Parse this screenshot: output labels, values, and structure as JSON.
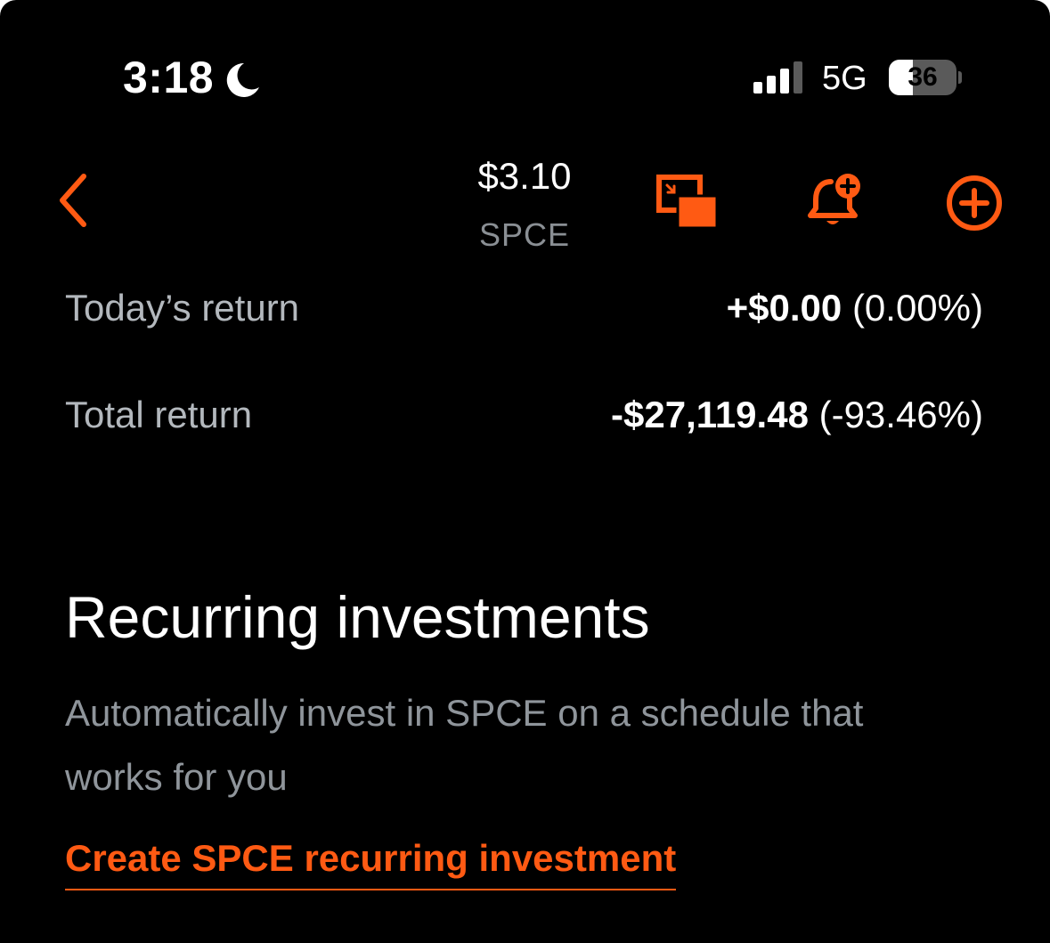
{
  "status_bar": {
    "time": "3:18",
    "network": "5G",
    "battery_percent": "36",
    "battery_level": 0.36
  },
  "header": {
    "price": "$3.10",
    "ticker": "SPCE"
  },
  "returns": {
    "today": {
      "label": "Today’s return",
      "amount": "+$0.00",
      "percent": "(0.00%)"
    },
    "total": {
      "label": "Total return",
      "amount": "-$27,119.48",
      "percent": "(-93.46%)"
    }
  },
  "recurring": {
    "title": "Recurring investments",
    "description": "Automatically invest in SPCE on a schedule that works for you",
    "create_link": "Create SPCE recurring investment"
  },
  "colors": {
    "accent": "#ff5a13",
    "background": "#000000",
    "muted_text": "#8f959b"
  },
  "icons": {
    "back": "chevron-left-icon",
    "pip": "picture-in-picture-icon",
    "alert": "bell-plus-icon",
    "add": "plus-circle-icon",
    "moon": "moon-icon",
    "signal": "signal-bars-icon"
  }
}
